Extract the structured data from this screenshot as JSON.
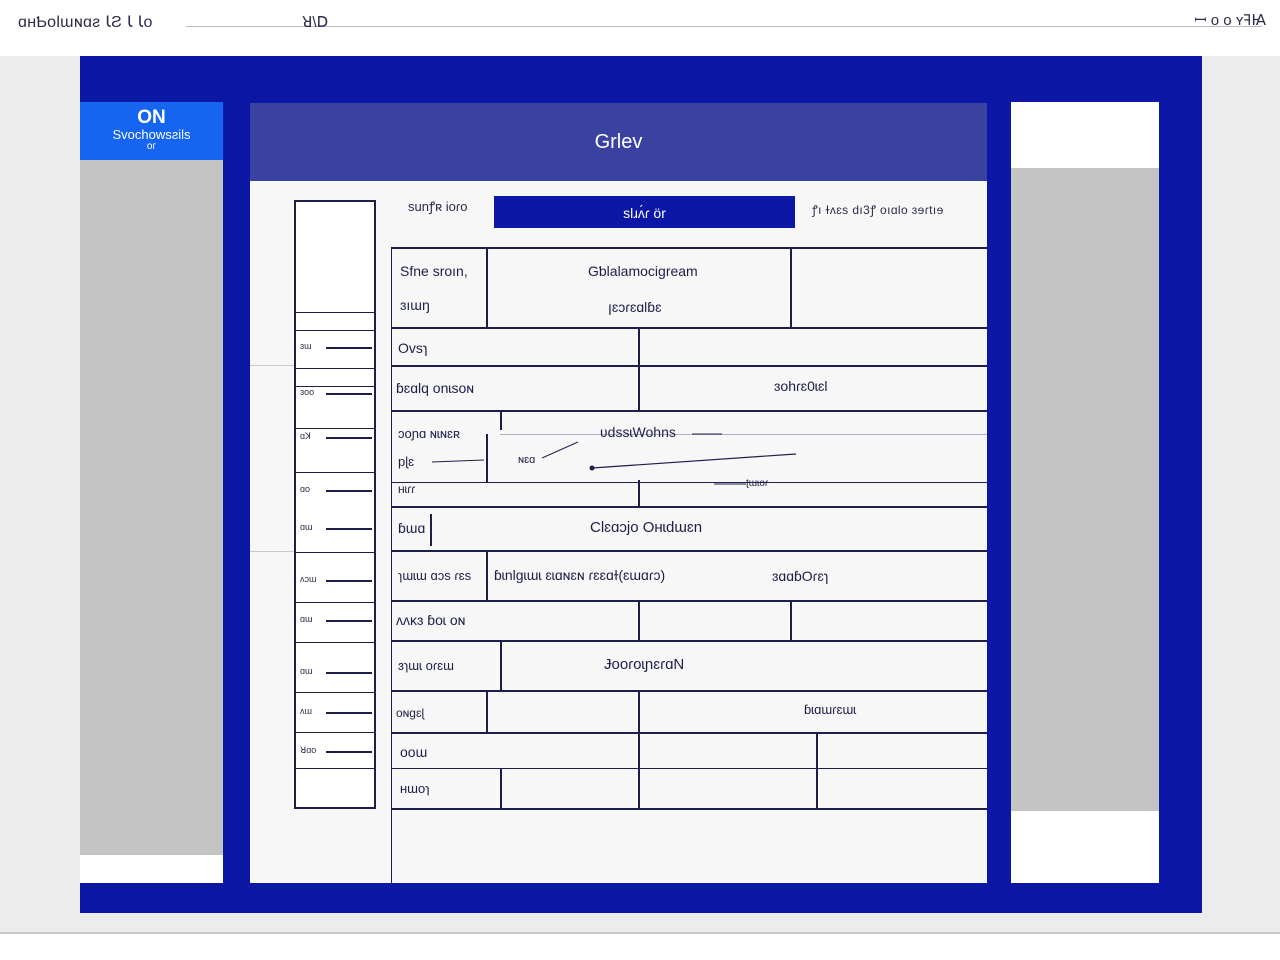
{
  "topbar": {
    "title": "ɑʜƄolɯɴɑƨ ꙆƧ Ꙇ Ꙇo",
    "menu": "ꓤ\\ꓓ",
    "right": "ꟷ o o ʏꟻꙖ"
  },
  "left_panel": {
    "badge_line1": "ON",
    "badge_line2": "Svochowsƨils",
    "badge_line3": "oᴦ"
  },
  "main": {
    "header_title": "Grlev",
    "control_label": "sunꝭʀ ioɾo",
    "control_button": "slɹʌ́ɾ ör",
    "control_stats": "ꝭı ɫʌɛs   dı3ꝭ   oıɑlo   ɜɘɾtıɘ"
  },
  "rail": {
    "labels": [
      "ɜɯ",
      "ɜoo",
      "ɑꓘ",
      "ɑo",
      "ɑɯ",
      "ᴧɔɯ",
      "ɑɯ",
      "ɑɯ",
      "ᴧɯ",
      "ꓤɑo"
    ]
  },
  "rows": {
    "r1": {
      "a": "Sfne sroın,",
      "b": "Gƅlalamocigream",
      "c": "ɜıɯŋ",
      "d": "ꞁɛɔɾɛɑlɓɛ"
    },
    "r2": {
      "a": "Ovsɿ"
    },
    "r3": {
      "a": "ɓɛɑlq  onɩsoɴ",
      "b": "ɜohɾɛ0ɩɛl"
    },
    "r4": {
      "a": "ɔoɲɑ  ɴɩɴɛʀ",
      "b": "ʋdssɩWohns",
      "c": "pɭɛ",
      "d": "ɴɛɑ",
      "e": "ʜɩɾɾ",
      "f": "ʈɯɩoɾ"
    },
    "r5": {
      "a": "ɓɯɑ",
      "b": "Clɛɑɔjo Oʜɩdɯɛn"
    },
    "r6": {
      "a": "ɿɯɩɯ  ɑɔs  ɾɛs",
      "b": "ɓɩnlɡɩɯɩ ɛɩɑɴɛɴ  ɾɛɛɑɫ(ɛɯɑɾɔ)",
      "c": "ɜɑɑɓOɾɛɿ"
    },
    "r7": {
      "a": "ᴧᴧᴋɜ  ɓoɩ oɴ"
    },
    "r8": {
      "a": "ɜɿɯɩ  oɾɛɯ",
      "b": "ɈooɾoɩɲɛɾɑN"
    },
    "r9": {
      "a": "oɴɡɛɭ",
      "b": "ɓɩɑɯɾɛɯɩ"
    },
    "r10": {
      "a": "ooɯ"
    },
    "r11": {
      "a": "ʜɯoɿ"
    }
  }
}
